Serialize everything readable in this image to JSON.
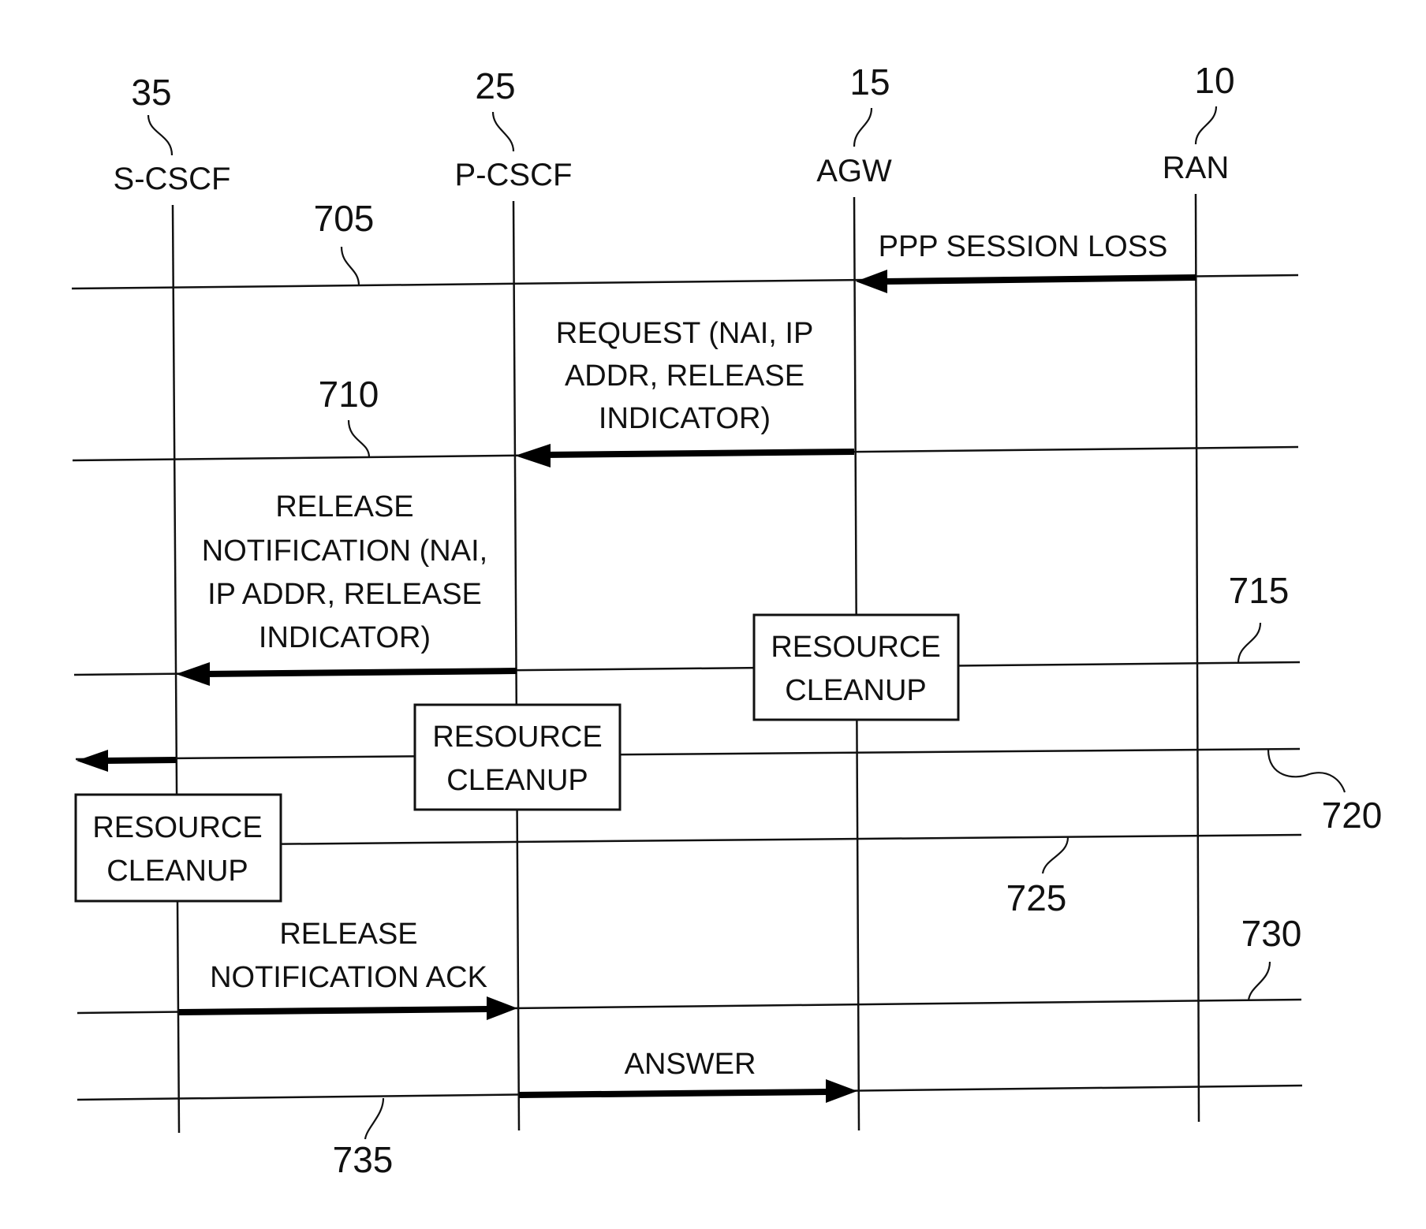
{
  "entities": [
    {
      "id": "s_cscf",
      "label": "S-CSCF",
      "ref": "35"
    },
    {
      "id": "p_cscf",
      "label": "P-CSCF",
      "ref": "25"
    },
    {
      "id": "agw",
      "label": "AGW",
      "ref": "15"
    },
    {
      "id": "ran",
      "label": "RAN",
      "ref": "10"
    }
  ],
  "steps": [
    {
      "ref": "705",
      "message": [
        "PPP SESSION LOSS"
      ],
      "from": "RAN",
      "to": "AGW"
    },
    {
      "ref": "710",
      "message": [
        "REQUEST (NAI, IP",
        "ADDR, RELEASE",
        "INDICATOR)"
      ],
      "from": "AGW",
      "to": "P-CSCF"
    },
    {
      "ref": "715",
      "message": [
        "RELEASE",
        "NOTIFICATION (NAI,",
        "IP ADDR, RELEASE",
        "INDICATOR)"
      ],
      "from": "P-CSCF",
      "to": "S-CSCF",
      "action": [
        "RESOURCE",
        "CLEANUP"
      ],
      "action_at": "AGW"
    },
    {
      "ref": "720",
      "message": [],
      "from": "S-CSCF",
      "to": "external",
      "action": [
        "RESOURCE",
        "CLEANUP"
      ],
      "action_at": "P-CSCF"
    },
    {
      "ref": "725",
      "message": [],
      "action": [
        "RESOURCE",
        "CLEANUP"
      ],
      "action_at": "S-CSCF"
    },
    {
      "ref": "730",
      "message": [
        "RELEASE",
        "NOTIFICATION ACK"
      ],
      "from": "S-CSCF",
      "to": "P-CSCF"
    },
    {
      "ref": "735",
      "message": [
        "ANSWER"
      ],
      "from": "P-CSCF",
      "to": "AGW"
    }
  ]
}
